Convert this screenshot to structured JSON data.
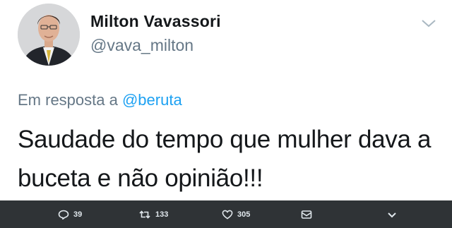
{
  "tweet": {
    "author_name": "Milton Vavassori",
    "author_handle": "@vava_milton",
    "reply_prefix": "Em resposta a",
    "reply_to": "@beruta",
    "text": "Saudade do tempo que mulher dava a buceta e não opinião!!!"
  },
  "icons": {
    "menu": "chevron-down-icon",
    "reply": "reply-icon",
    "retweet": "retweet-icon",
    "like": "heart-icon",
    "dm": "envelope-icon",
    "more": "chevron-down-icon"
  },
  "actions": {
    "reply_count": "39",
    "retweet_count": "133",
    "like_count": "305"
  },
  "colors": {
    "mention": "#1da1f2",
    "secondary_text": "#657786",
    "action_bar": "#2f3336"
  }
}
